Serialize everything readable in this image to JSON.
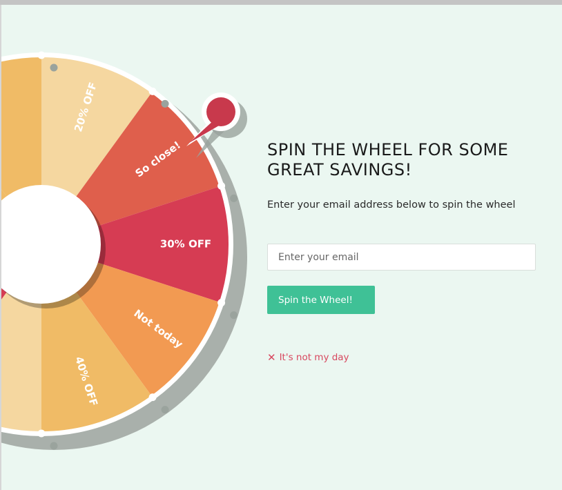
{
  "wheel": {
    "segments": [
      {
        "label": "20% OFF",
        "color": "#f5d7a0"
      },
      {
        "label": "So close!",
        "color": "#df5f4c"
      },
      {
        "label": "30% OFF",
        "color": "#d63c53"
      },
      {
        "label": "Not today",
        "color": "#f29a52"
      },
      {
        "label": "40% OFF",
        "color": "#f0bb66"
      },
      {
        "label": "",
        "color": "#f5d7a0"
      },
      {
        "label": "",
        "color": "#d63c53"
      },
      {
        "label": "",
        "color": "#f29a52"
      },
      {
        "label": "",
        "color": "#f0bb66"
      },
      {
        "label": "",
        "color": "#f0bb66"
      }
    ],
    "pointer_color": "#c8394c",
    "rim_color": "#ffffff",
    "shadow_color": "#a9b0ab"
  },
  "panel": {
    "title": "SPIN THE WHEEL FOR SOME GREAT SAVINGS!",
    "subtitle": "Enter your email address below to spin the wheel",
    "email_placeholder": "Enter your email",
    "spin_button": "Spin the Wheel!",
    "dismiss_icon": "close-icon",
    "dismiss_label": "It's not my day",
    "accent_color": "#3fc196",
    "dismiss_color": "#d8485f"
  }
}
